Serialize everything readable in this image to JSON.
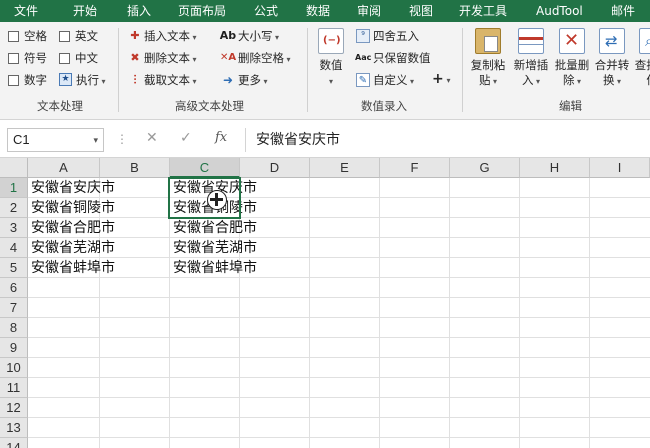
{
  "menu": {
    "items": [
      "文件",
      "开始",
      "插入",
      "页面布局",
      "公式",
      "数据",
      "审阅",
      "视图",
      "开发工具",
      "AudTool",
      "邮件"
    ]
  },
  "ribbon": {
    "text_group": {
      "checkboxes": [
        "空格",
        "英文",
        "符号",
        "中文",
        "数字"
      ],
      "exec_label": "执行",
      "label": "文本处理"
    },
    "advanced_text": {
      "insert_text": "插入文本",
      "delete_text": "删除文本",
      "extract_text": "截取文本",
      "case": "大小写",
      "delete_spaces": "删除空格",
      "more": "更多",
      "label": "高级文本处理"
    },
    "numeric": {
      "value": "数值",
      "round": "四舍五入",
      "keep_values": "只保留数值",
      "custom": "自定义",
      "plus": "+",
      "label": "数值录入"
    },
    "edit": {
      "copy_paste": [
        "复制粘",
        "贴"
      ],
      "insert_new": [
        "新增插",
        "入"
      ],
      "batch_delete": [
        "批量删",
        "除"
      ],
      "merge_convert": [
        "合并转",
        "换"
      ],
      "find_locate": [
        "查找定",
        "位"
      ],
      "label": "编辑"
    }
  },
  "formula_bar": {
    "name_box": "C1",
    "fx": "fx",
    "formula": "安徽省安庆市"
  },
  "sheet": {
    "columns": [
      "A",
      "B",
      "C",
      "D",
      "E",
      "F",
      "G",
      "H",
      "I"
    ],
    "rows": [
      "1",
      "2",
      "3",
      "4",
      "5",
      "6",
      "7",
      "8",
      "9",
      "10",
      "11",
      "12",
      "13",
      "14"
    ],
    "col_a": [
      "安徽省安庆市",
      "安徽省铜陵市",
      "安徽省合肥市",
      "安徽省芜湖市",
      "安徽省蚌埠市"
    ],
    "col_c": [
      "安徽省安庆市",
      "安徽省铜陵市",
      "安徽省合肥市",
      "安徽省芜湖市",
      "安徽省蚌埠市"
    ]
  },
  "colors": {
    "accent": "#217346",
    "ribbon_bg": "#f3f3f3"
  }
}
